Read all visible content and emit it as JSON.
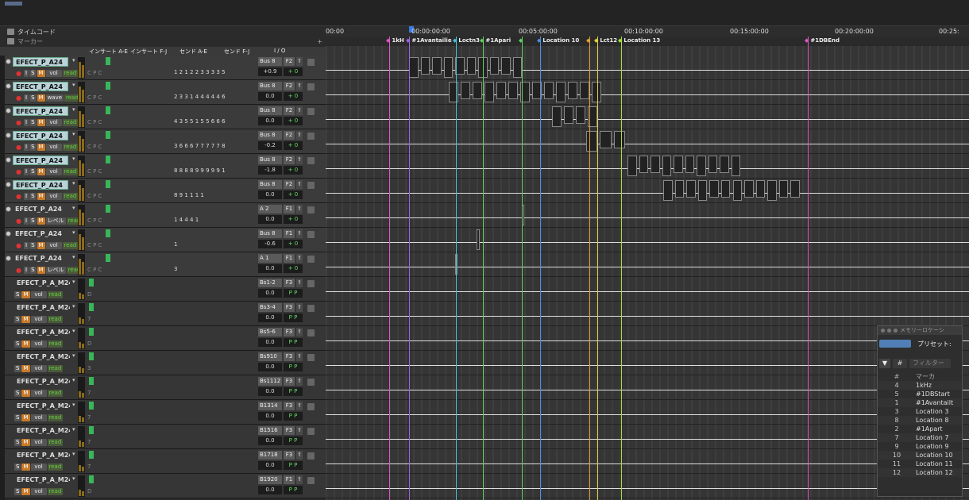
{
  "header": {
    "timecode_label": "タイムコード",
    "marker_label": "マーカー"
  },
  "columns": {
    "insert_ae": "インサート A-E",
    "insert_fj": "インサート F-J",
    "send_ae": "センド A-E",
    "send_fj": "センド F-J",
    "io": "I / O"
  },
  "ruler": [
    "00:00",
    "00:00:00:00",
    "00:05:00:00",
    "00:10:00:00",
    "00:15:00:00",
    "00:20:00:00",
    "00:25:"
  ],
  "markers": [
    {
      "label": "1kH",
      "color": "#e055c8"
    },
    {
      "label": "#1Avantailie",
      "color": "#a060e0"
    },
    {
      "label": "Loctn3",
      "color": "#45c0d8"
    },
    {
      "label": "#1Apari",
      "color": "#60d060"
    },
    {
      "label": "",
      "color": "#60d060"
    },
    {
      "label": "Location 10",
      "color": "#4a90e0"
    },
    {
      "label": "",
      "color": "#e0a030"
    },
    {
      "label": "Lct12",
      "color": "#e0d040"
    },
    {
      "label": "Location 13",
      "color": "#a0e040"
    },
    {
      "label": "#1DBEnd",
      "color": "#e055c8"
    }
  ],
  "tracks": [
    {
      "name": "EFECT_P_A24",
      "mode": "vol",
      "bus": "Bus 8",
      "out": "F2",
      "vol": "+0.9",
      "pan": "+ 0",
      "sends": "1 2 1 2 2 3 3 3 3 5",
      "selected": true
    },
    {
      "name": "EFECT_P_A24",
      "mode": "wave",
      "bus": "Bus 8",
      "out": "F2",
      "vol": "0.0",
      "pan": "+ 0",
      "sends": "2 3 3 1 4 4 4 4 4 6",
      "selected": true
    },
    {
      "name": "EFECT_P_A24",
      "mode": "vol",
      "bus": "Bus 8",
      "out": "F2",
      "vol": "0.0",
      "pan": "+ 0",
      "sends": "4 3 5 5 1 5 5 6 6 6",
      "selected": true
    },
    {
      "name": "EFECT_P_A24",
      "mode": "vol",
      "bus": "Bus 8",
      "out": "F2",
      "vol": "-0.2",
      "pan": "+ 0",
      "sends": "3 6 6 6 7 7 7 7 7 8",
      "selected": true
    },
    {
      "name": "EFECT_P_A24",
      "mode": "vol",
      "bus": "Bus 8",
      "out": "F2",
      "vol": "-1.8",
      "pan": "+ 0",
      "sends": "8 8 8 8 9 9 9 9 9 1",
      "selected": true
    },
    {
      "name": "EFECT_P_A24",
      "mode": "vol",
      "bus": "Bus 8",
      "out": "F2",
      "vol": "0.0",
      "pan": "+ 0",
      "sends": "8 9 1 1 1 1",
      "selected": true
    },
    {
      "name": "EFECT_P_A24",
      "mode": "レベル",
      "bus": "A 2",
      "out": "F1",
      "vol": "0.0",
      "pan": "+ 0",
      "sends": "1 4 4 4 1",
      "selected": false
    },
    {
      "name": "EFECT_P_A24",
      "mode": "vol",
      "bus": "Bus 8",
      "out": "F1",
      "vol": "-0.6",
      "pan": "+ 0",
      "sends": "1",
      "selected": false
    },
    {
      "name": "EFECT_P_A24",
      "mode": "レベル",
      "bus": "A 1",
      "out": "F1",
      "vol": "0.0",
      "pan": "+ 0",
      "sends": "3",
      "selected": false
    },
    {
      "name": "EFECT_P_A_M24",
      "mode": "vol",
      "bus": "Bs1-2",
      "out": "F3",
      "vol": "0.0",
      "pan": "P P",
      "ins": "D",
      "midi": true
    },
    {
      "name": "EFECT_P_A_M24",
      "mode": "vol",
      "bus": "Bs3-4",
      "out": "F3",
      "vol": "0.0",
      "pan": "P P",
      "ins": "7",
      "midi": true
    },
    {
      "name": "EFECT_P_A_M24",
      "mode": "vol",
      "bus": "Bs5-6",
      "out": "F3",
      "vol": "0.0",
      "pan": "P P",
      "ins": "D",
      "midi": true
    },
    {
      "name": "EFECT_P_A_M24",
      "mode": "vol",
      "bus": "Bs910",
      "out": "F3",
      "vol": "0.0",
      "pan": "P P",
      "ins": "3",
      "midi": true
    },
    {
      "name": "EFECT_P_A_M24",
      "mode": "vol",
      "bus": "Bs1112",
      "out": "F3",
      "vol": "0.0",
      "pan": "P P",
      "ins": "7",
      "midi": true
    },
    {
      "name": "EFECT_P_A_M24",
      "mode": "vol",
      "bus": "B1314",
      "out": "F3",
      "vol": "0.0",
      "pan": "P P",
      "ins": "7",
      "midi": true
    },
    {
      "name": "EFECT_P_A_M24",
      "mode": "vol",
      "bus": "B1516",
      "out": "F3",
      "vol": "0.0",
      "pan": "P P",
      "ins": "7",
      "midi": true
    },
    {
      "name": "EFECT_P_A_M24",
      "mode": "vol",
      "bus": "B1718",
      "out": "F3",
      "vol": "0.0",
      "pan": "P P",
      "ins": "7",
      "midi": true
    },
    {
      "name": "EFECT_P_A_M24",
      "mode": "vol",
      "bus": "B1920",
      "out": "F1",
      "vol": "0.0",
      "pan": "P P",
      "ins": "D",
      "midi": true
    }
  ],
  "memory_panel": {
    "title": "メモリーロケーシ",
    "preset_label": "プリセット:",
    "filter_placeholder": "フィルター",
    "col_num": "#",
    "col_marker": "マーカ",
    "rows": [
      {
        "num": "4",
        "name": "1kHz"
      },
      {
        "num": "5",
        "name": "#1DBStart"
      },
      {
        "num": "1",
        "name": "#1Avantailt"
      },
      {
        "num": "3",
        "name": "Location 3"
      },
      {
        "num": "8",
        "name": "Location 8"
      },
      {
        "num": "2",
        "name": "#1Apart"
      },
      {
        "num": "7",
        "name": "Location 7"
      },
      {
        "num": "9",
        "name": "Location 9"
      },
      {
        "num": "10",
        "name": "Location 10"
      },
      {
        "num": "11",
        "name": "Location 11"
      },
      {
        "num": "12",
        "name": "Location 12"
      }
    ]
  }
}
